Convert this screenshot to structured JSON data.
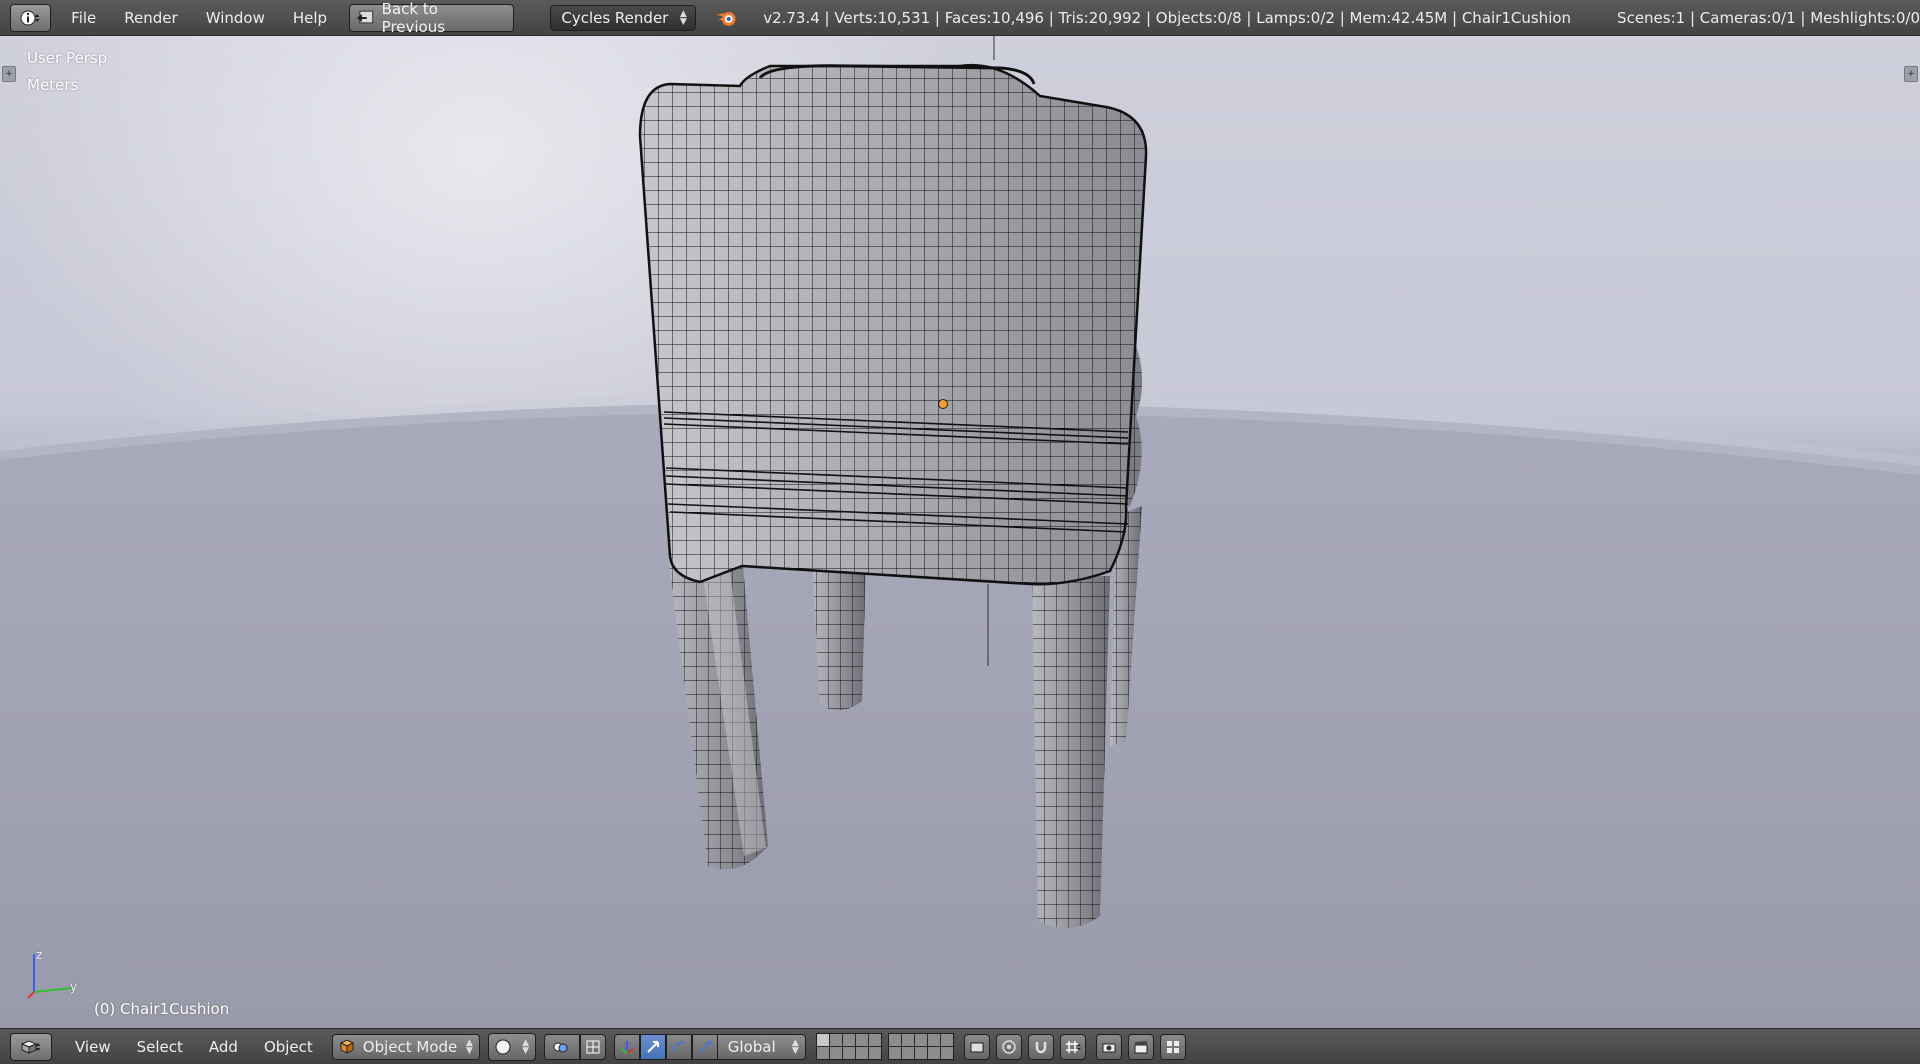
{
  "topbar": {
    "menu": [
      "File",
      "Render",
      "Window",
      "Help"
    ],
    "back_label": "Back to Previous",
    "render_engine": "Cycles Render",
    "stats": "v2.73.4 | Verts:10,531 | Faces:10,496 | Tris:20,992 | Objects:0/8 | Lamps:0/2 | Mem:42.45M | Chair1Cushion",
    "scene_stats": "Scenes:1 | Cameras:0/1 | Meshlights:0/0"
  },
  "viewport": {
    "view_name": "User Persp",
    "units": "Meters",
    "active_object": "(0) Chair1Cushion",
    "axis_z": "z",
    "axis_y": "y"
  },
  "bottombar": {
    "menu": [
      "View",
      "Select",
      "Add",
      "Object"
    ],
    "mode": "Object Mode",
    "orientation": "Global"
  },
  "colors": {
    "accent_blue": "#5580c8",
    "origin_dot": "#f0a030",
    "mesh_fill": "#9a9aa3",
    "wire": "#111111"
  }
}
